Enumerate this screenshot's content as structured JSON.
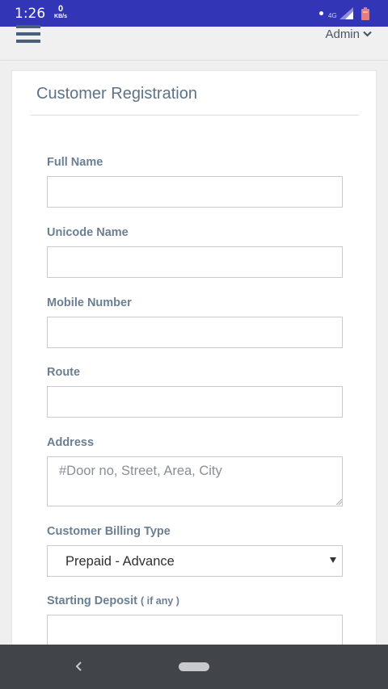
{
  "status_bar": {
    "time": "1:26",
    "speed_value": "0",
    "speed_unit": "KB/s",
    "network": "4G",
    "icons": [
      "notification-dot",
      "signal-icon",
      "battery-icon"
    ]
  },
  "topbar": {
    "menu_icon": "hamburger-menu-icon",
    "user_label": "Admin",
    "user_icon": "chevron-down-icon"
  },
  "form": {
    "title": "Customer Registration",
    "fields": {
      "full_name": {
        "label": "Full Name",
        "value": ""
      },
      "unicode_name": {
        "label": "Unicode Name",
        "value": ""
      },
      "mobile_number": {
        "label": "Mobile Number",
        "value": ""
      },
      "route": {
        "label": "Route",
        "value": ""
      },
      "address": {
        "label": "Address",
        "value": "",
        "placeholder": "#Door no, Street, Area, City"
      },
      "billing_type": {
        "label": "Customer Billing Type",
        "selected": "Prepaid - Advance"
      },
      "starting_deposit": {
        "label": "Starting Deposit",
        "hint": "( if any )",
        "value": ""
      }
    }
  },
  "nav_bar": {
    "icons": [
      "back-icon",
      "home-pill-icon"
    ]
  },
  "colors": {
    "status_bar": "#3236b6",
    "label": "#6b7f92",
    "title": "#5e7286",
    "nav_bar": "#414448"
  }
}
